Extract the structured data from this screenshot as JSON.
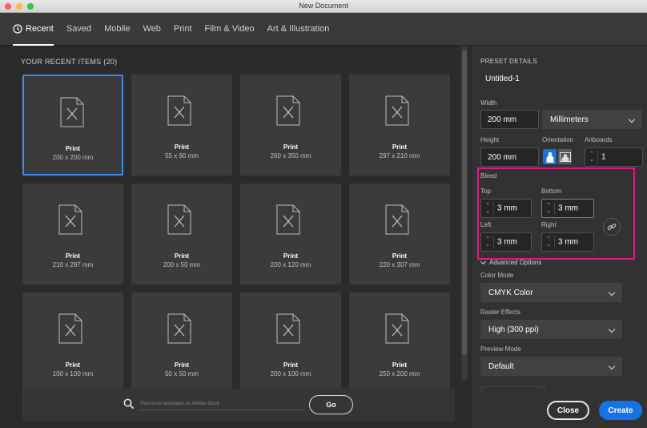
{
  "window": {
    "title": "New Document",
    "traffic_lights": [
      "#ff5f57",
      "#febc2e",
      "#28c840"
    ]
  },
  "tabs": [
    {
      "label": "Recent",
      "icon": "clock-icon",
      "active": true
    },
    {
      "label": "Saved"
    },
    {
      "label": "Mobile"
    },
    {
      "label": "Web"
    },
    {
      "label": "Print"
    },
    {
      "label": "Film & Video"
    },
    {
      "label": "Art & Illustration"
    }
  ],
  "recent": {
    "header": "YOUR RECENT ITEMS",
    "count": "(20)",
    "items": [
      {
        "name": "Print",
        "size": "200 x 200 mm"
      },
      {
        "name": "Print",
        "size": "55 x 90 mm"
      },
      {
        "name": "Print",
        "size": "260 x 350 mm"
      },
      {
        "name": "Print",
        "size": "297 x 210 mm"
      },
      {
        "name": "Print",
        "size": "210 x 297 mm"
      },
      {
        "name": "Print",
        "size": "200 x 50 mm"
      },
      {
        "name": "Print",
        "size": "200 x 120 mm"
      },
      {
        "name": "Print",
        "size": "220 x 307 mm"
      },
      {
        "name": "Print",
        "size": "100 x 100 mm"
      },
      {
        "name": "Print",
        "size": "50 x 50 mm"
      },
      {
        "name": "Print",
        "size": "200 x 100 mm"
      },
      {
        "name": "Print",
        "size": "250 x 200 mm"
      }
    ]
  },
  "search": {
    "placeholder": "Find more templates on Adobe Stock",
    "go_label": "Go"
  },
  "preset": {
    "section_title": "PRESET DETAILS",
    "doc_name": "Untitled-1",
    "width_label": "Width",
    "width_value": "200 mm",
    "units_value": "Millimeters",
    "height_label": "Height",
    "height_value": "200 mm",
    "orientation_label": "Orientation",
    "artboards_label": "Artboards",
    "artboards_value": "1",
    "bleed_label": "Bleed",
    "top_label": "Top",
    "top_value": "3 mm",
    "bottom_label": "Bottom",
    "bottom_value": "3 mm",
    "left_label": "Left",
    "left_value": "3 mm",
    "right_label": "Right",
    "right_value": "3 mm",
    "advanced_label": "Advanced Options",
    "color_mode_label": "Color Mode",
    "color_mode_value": "CMYK Color",
    "raster_label": "Raster Effects",
    "raster_value": "High (300 ppi)",
    "preview_label": "Preview Mode",
    "preview_value": "Default"
  },
  "buttons": {
    "close": "Close",
    "create": "Create"
  },
  "colors": {
    "accent": "#1473e6",
    "selection": "#378ef0",
    "highlight_box": "#e5168b"
  }
}
